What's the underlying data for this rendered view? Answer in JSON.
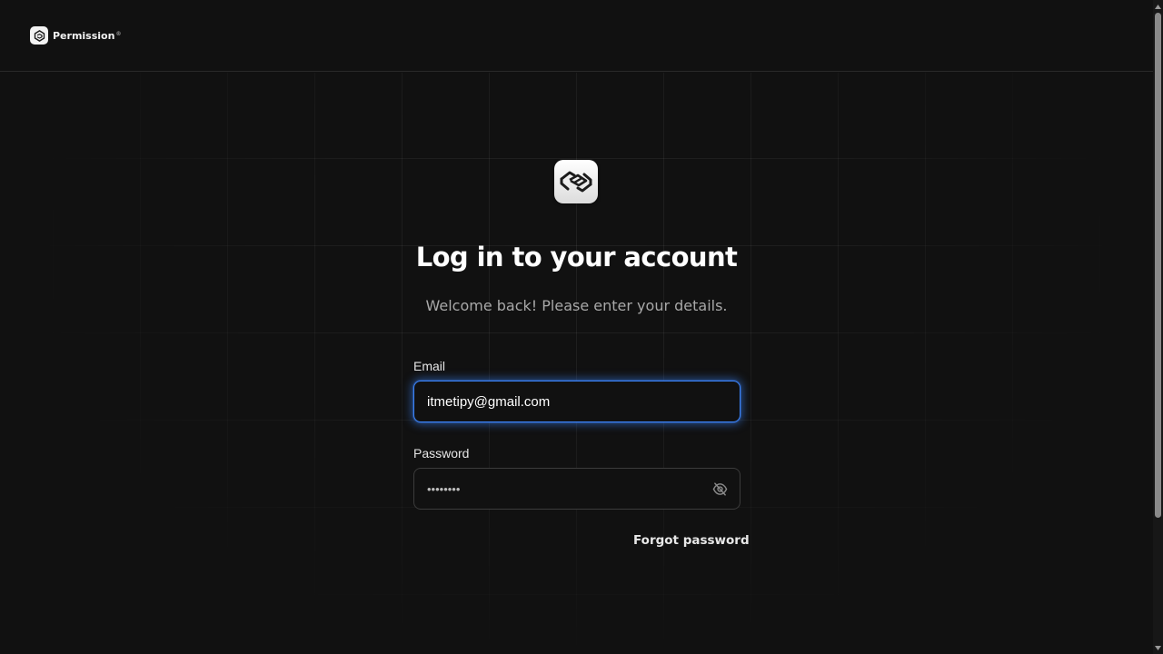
{
  "brand": {
    "name": "Permission",
    "registered_mark": "®"
  },
  "login": {
    "title": "Log in to your account",
    "subtitle": "Welcome back! Please enter your details."
  },
  "form": {
    "email_label": "Email",
    "email_value": "itmetipy@gmail.com",
    "password_label": "Password",
    "password_masked": "••••••••",
    "forgot_label": "Forgot password"
  },
  "colors": {
    "background": "#111111",
    "focus_ring": "#3b82f6",
    "text_primary": "#ffffff",
    "text_muted": "#a8a8a8"
  },
  "icons": {
    "brand": "permission-logo-icon",
    "app": "handshake-logo-icon",
    "password_toggle": "eye-off-icon"
  }
}
